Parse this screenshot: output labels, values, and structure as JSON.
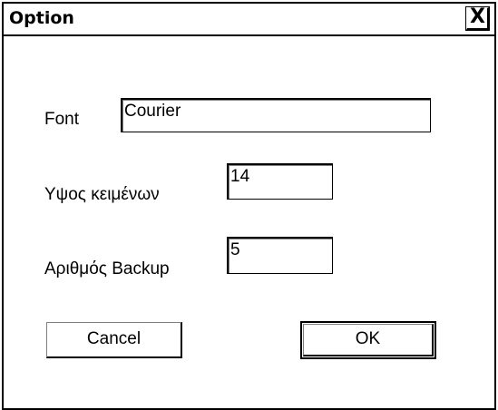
{
  "window": {
    "title": "Option",
    "close_glyph": "X"
  },
  "form": {
    "font_label": "Font",
    "font_value": "Courier",
    "text_size_label": "Υψος κειμένων",
    "text_size_value": "14",
    "backup_label": "Αριθμός Backup",
    "backup_value": "5"
  },
  "buttons": {
    "cancel_label": "Cancel",
    "ok_label": "OK"
  }
}
